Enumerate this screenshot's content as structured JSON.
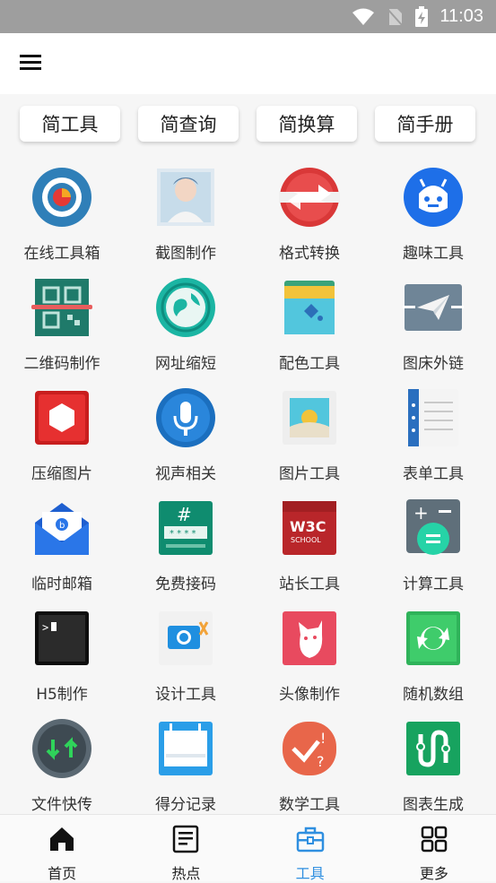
{
  "status_bar": {
    "time": "11:03"
  },
  "categories": [
    "简工具",
    "简查询",
    "简换算",
    "简手册"
  ],
  "tools": [
    {
      "label": "在线工具箱",
      "icon": "toolbox-gear-icon"
    },
    {
      "label": "截图制作",
      "icon": "portrait-screenshot-icon"
    },
    {
      "label": "格式转换",
      "icon": "swap-arrows-icon"
    },
    {
      "label": "趣味工具",
      "icon": "robot-face-icon"
    },
    {
      "label": "二维码制作",
      "icon": "qr-code-scan-icon"
    },
    {
      "label": "网址缩短",
      "icon": "globe-link-icon"
    },
    {
      "label": "配色工具",
      "icon": "paint-bucket-icon"
    },
    {
      "label": "图床外链",
      "icon": "paper-plane-icon"
    },
    {
      "label": "压缩图片",
      "icon": "hexagon-compress-icon"
    },
    {
      "label": "视声相关",
      "icon": "microphone-icon"
    },
    {
      "label": "图片工具",
      "icon": "landscape-picture-icon"
    },
    {
      "label": "表单工具",
      "icon": "form-list-icon"
    },
    {
      "label": "临时邮箱",
      "icon": "mail-envelope-icon"
    },
    {
      "label": "免费接码",
      "icon": "sms-code-icon"
    },
    {
      "label": "站长工具",
      "icon": "w3c-school-icon"
    },
    {
      "label": "计算工具",
      "icon": "calculator-icon"
    },
    {
      "label": "H5制作",
      "icon": "terminal-icon"
    },
    {
      "label": "设计工具",
      "icon": "camera-scissors-icon"
    },
    {
      "label": "头像制作",
      "icon": "cat-avatar-icon"
    },
    {
      "label": "随机数组",
      "icon": "refresh-random-icon"
    },
    {
      "label": "文件快传",
      "icon": "transfer-arrows-icon"
    },
    {
      "label": "得分记录",
      "icon": "score-calendar-icon"
    },
    {
      "label": "数学工具",
      "icon": "math-check-icon"
    },
    {
      "label": "图表生成",
      "icon": "chart-path-icon"
    }
  ],
  "bottom_nav": [
    {
      "label": "首页",
      "icon": "home-icon"
    },
    {
      "label": "热点",
      "icon": "news-icon"
    },
    {
      "label": "工具",
      "icon": "toolbox-icon"
    },
    {
      "label": "更多",
      "icon": "grid-more-icon"
    }
  ],
  "colors": {
    "accent": "#2f8fe0",
    "status_bar": "#9e9e9e"
  }
}
